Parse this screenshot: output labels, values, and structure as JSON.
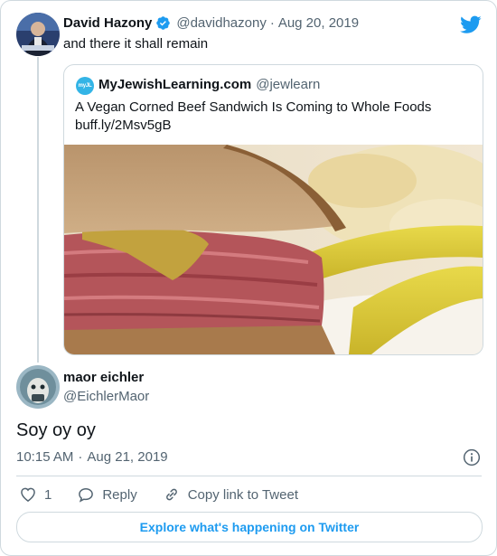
{
  "tweet": {
    "author_name": "David Hazony",
    "author_handle": "@davidhazony",
    "separator": "·",
    "date": "Aug 20, 2019",
    "text": "and there it shall remain"
  },
  "quote": {
    "author_name": "MyJewishLearning.com",
    "author_handle": "@jewlearn",
    "text": "A Vegan Corned Beef Sandwich Is Coming to Whole Foods",
    "link": "buff.ly/2Msv5gB",
    "avatar_label": "myJL"
  },
  "reply": {
    "author_name": "maor eichler",
    "author_handle": "@EichlerMaor",
    "text": "Soy oy oy",
    "time": "10:15 AM",
    "date": "Aug 21, 2019"
  },
  "actions": {
    "like_count": "1",
    "reply_label": "Reply",
    "copy_label": "Copy link to Tweet"
  },
  "footer": {
    "explore_label": "Explore what's happening on Twitter"
  },
  "colors": {
    "accent": "#1d9bf0",
    "muted": "#536471",
    "border": "#cfd9de"
  }
}
